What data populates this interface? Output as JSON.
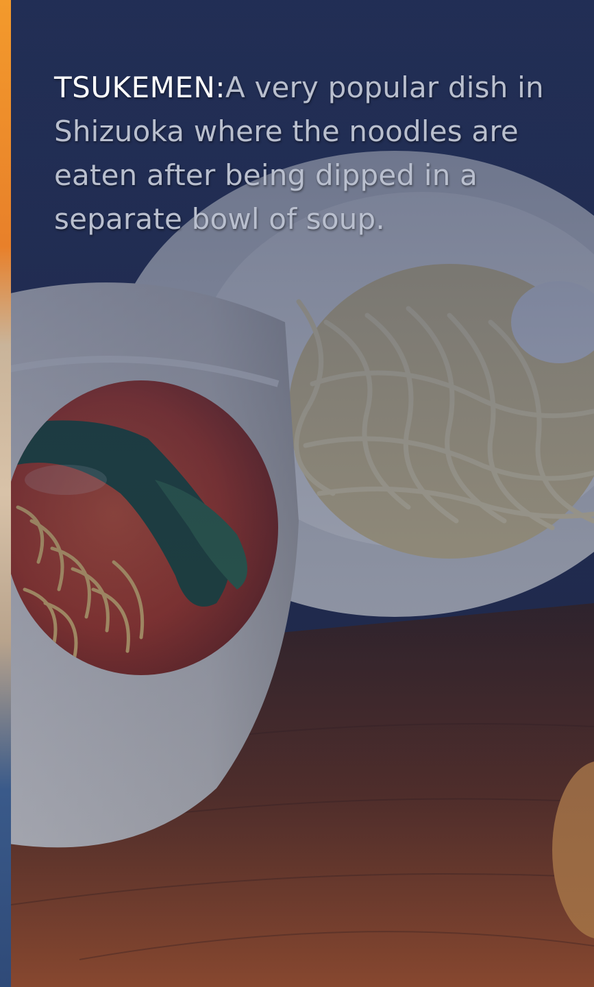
{
  "caption": {
    "term": "TSUKEMEN:",
    "description": "A very popular dish in Shizuoka where the noodles are eaten after being dipped in a separate bowl of soup."
  },
  "photo": {
    "subject": "tsukemen: bowl of red dipping soup with greens beside a plate of noodles on a wooden table",
    "overlay_color": "#1c2a55"
  },
  "colors": {
    "overlay": "#1c2a55",
    "caption_term": "#ffffff",
    "caption_text": "#b9bfce",
    "left_strip_top": "#f39a2c",
    "left_strip_bottom": "#3a5a8a"
  }
}
